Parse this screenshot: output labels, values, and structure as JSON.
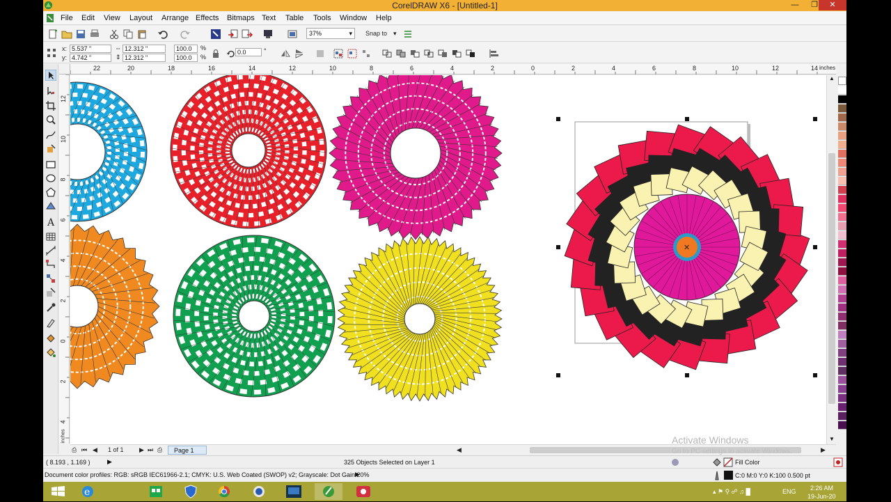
{
  "window": {
    "title": "CorelDRAW X6 - [Untitled-1]"
  },
  "menu": [
    "File",
    "Edit",
    "View",
    "Layout",
    "Arrange",
    "Effects",
    "Bitmaps",
    "Text",
    "Table",
    "Tools",
    "Window",
    "Help"
  ],
  "toolbar": {
    "zoom": "37%",
    "snap_to": "Snap to"
  },
  "property_bar": {
    "x_label": "x:",
    "x_value": "5.537 \"",
    "y_label": "y:",
    "y_value": "4.742 \"",
    "w_value": "12.312 \"",
    "h_value": "12.312 \"",
    "scale_w": "100.0",
    "scale_h": "100.0",
    "pct": "%",
    "rotation": "0.0",
    "deg": "°"
  },
  "ruler": {
    "h_ticks": [
      "22",
      "20",
      "18",
      "16",
      "14",
      "12",
      "10",
      "8",
      "6",
      "4",
      "2",
      "0",
      "2",
      "4",
      "6",
      "8",
      "10",
      "12",
      "14"
    ],
    "unit": "inches",
    "v_ticks": [
      "12",
      "10",
      "8",
      "6",
      "4",
      "2",
      "0",
      "2",
      "4"
    ],
    "v_unit": "inches"
  },
  "page_nav": {
    "count": "1 of 1",
    "tab": "Page 1"
  },
  "status": {
    "coords": "( 8.193 , 1.169 )",
    "selection": "325 Objects Selected on Layer 1",
    "color_profile": "Document color profiles: RGB: sRGB IEC61966-2.1; CMYK: U.S. Web Coated (SWOP) v2; Grayscale: Dot Gain 20%",
    "fill_label": "Fill Color",
    "outline_label": "C:0 M:0 Y:0 K:100  0.500 pt"
  },
  "watermark": {
    "line1": "Activate Windows",
    "line2": "Go to PC settings to activate Windows."
  },
  "taskbar": {
    "lang": "ENG",
    "time": "2:26 AM",
    "date": "19-Jun-20"
  },
  "palette_colors": [
    "#ffffff",
    "#000000",
    "#7a5a3a",
    "#a06a4a",
    "#c98a6a",
    "#e8a080",
    "#f0b090",
    "#e07060",
    "#f08878",
    "#f0a090",
    "#f8c0b0",
    "#d04050",
    "#e03060",
    "#f04870",
    "#f07090",
    "#e8a0b0",
    "#f0c0d0",
    "#d03070",
    "#c02060",
    "#a01850",
    "#901040",
    "#e060a0",
    "#d070b0",
    "#b04090",
    "#a03080",
    "#903070",
    "#803060",
    "#c080c0",
    "#a060a0",
    "#804080",
    "#703070",
    "#603060",
    "#9a509a",
    "#8a4090",
    "#7a3080",
    "#6a2070",
    "#5a2060",
    "#4a1050"
  ]
}
